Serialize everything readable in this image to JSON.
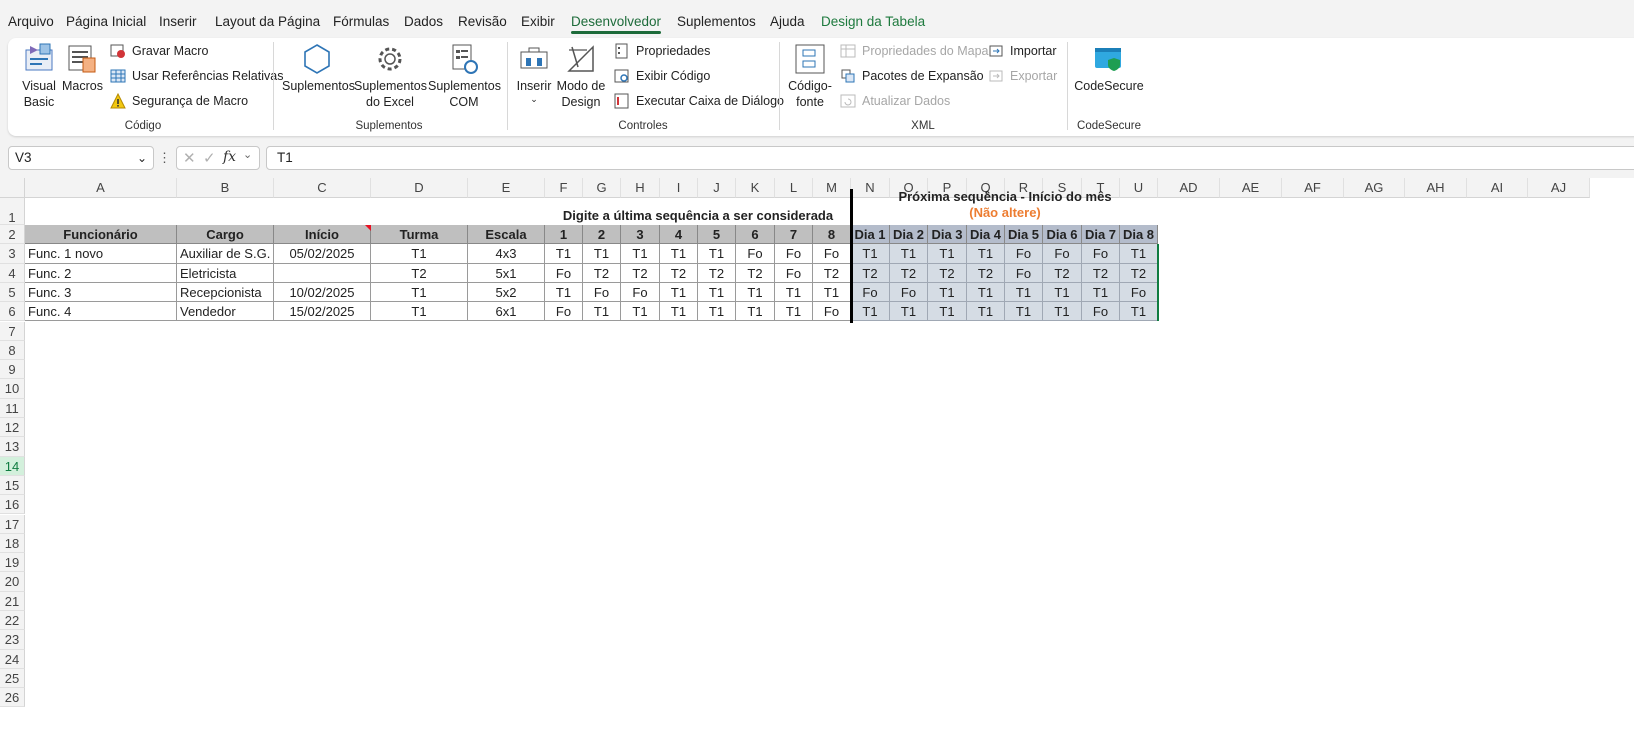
{
  "menu": [
    "Arquivo",
    "Página Inicial",
    "Inserir",
    "Layout da Página",
    "Fórmulas",
    "Dados",
    "Revisão",
    "Exibir",
    "Desenvolvedor",
    "Suplementos",
    "Ajuda",
    "Design da Tabela"
  ],
  "ribbon": {
    "codigo": {
      "label": "Código",
      "visual_basic": "Visual\nBasic",
      "macros": "Macros",
      "gravar_macro": "Gravar Macro",
      "usar_refs": "Usar Referências Relativas",
      "seguranca": "Segurança de Macro"
    },
    "suplementos": {
      "label": "Suplementos",
      "suplementos": "Suplementos",
      "suplementos_excel": "Suplementos\ndo Excel",
      "suplementos_com": "Suplementos\nCOM"
    },
    "controles": {
      "label": "Controles",
      "inserir": "Inserir",
      "modo_design": "Modo de\nDesign",
      "propriedades": "Propriedades",
      "exibir_codigo": "Exibir Código",
      "executar": "Executar Caixa de Diálogo"
    },
    "xml": {
      "label": "XML",
      "codigo_fonte": "Código-\nfonte",
      "prop_mapa": "Propriedades do Mapa",
      "pacotes": "Pacotes de Expansão",
      "atualizar": "Atualizar Dados",
      "importar": "Importar",
      "exportar": "Exportar"
    },
    "codesecure": {
      "label": "CodeSecure",
      "btn": "CodeSecure"
    }
  },
  "namebox": "V3",
  "formula": "T1",
  "columns": [
    "A",
    "B",
    "C",
    "D",
    "E",
    "F",
    "G",
    "H",
    "I",
    "J",
    "K",
    "L",
    "M",
    "N",
    "O",
    "P",
    "Q",
    "R",
    "S",
    "T",
    "U",
    "AD",
    "AE",
    "AF",
    "AG",
    "AH",
    "AI",
    "AJ"
  ],
  "rows": [
    "1",
    "2",
    "3",
    "4",
    "5",
    "6",
    "7",
    "8",
    "9",
    "10",
    "11",
    "12",
    "13",
    "14",
    "15",
    "16",
    "17",
    "18",
    "19",
    "20",
    "21",
    "22",
    "23",
    "24",
    "25",
    "26"
  ],
  "table": {
    "title_left": "Digite a última sequência a ser considerada",
    "title_right": "Próxima sequência - Início do mês",
    "title_right_note": "(Não altere)",
    "headers": [
      "Funcionário",
      "Cargo",
      "Início",
      "Turma",
      "Escala",
      "1",
      "2",
      "3",
      "4",
      "5",
      "6",
      "7",
      "8",
      "Dia 1",
      "Dia 2",
      "Dia 3",
      "Dia 4",
      "Dia 5",
      "Dia 6",
      "Dia 7",
      "Dia 8"
    ],
    "rows": [
      [
        "Func. 1 novo",
        "Auxiliar de S.G.",
        "05/02/2025",
        "T1",
        "4x3",
        "T1",
        "T1",
        "T1",
        "T1",
        "T1",
        "Fo",
        "Fo",
        "Fo",
        "T1",
        "T1",
        "T1",
        "T1",
        "Fo",
        "Fo",
        "Fo",
        "T1"
      ],
      [
        "Func. 2",
        "Eletricista",
        "",
        "T2",
        "5x1",
        "Fo",
        "T2",
        "T2",
        "T2",
        "T2",
        "T2",
        "Fo",
        "T2",
        "T2",
        "T2",
        "T2",
        "T2",
        "Fo",
        "T2",
        "T2",
        "T2"
      ],
      [
        "Func. 3",
        "Recepcionista",
        "10/02/2025",
        "T1",
        "5x2",
        "T1",
        "Fo",
        "Fo",
        "T1",
        "T1",
        "T1",
        "T1",
        "T1",
        "Fo",
        "Fo",
        "T1",
        "T1",
        "T1",
        "T1",
        "T1",
        "Fo"
      ],
      [
        "Func. 4",
        "Vendedor",
        "15/02/2025",
        "T1",
        "6x1",
        "Fo",
        "T1",
        "T1",
        "T1",
        "T1",
        "T1",
        "T1",
        "Fo",
        "T1",
        "T1",
        "T1",
        "T1",
        "T1",
        "T1",
        "Fo",
        "T1"
      ]
    ]
  },
  "colors": {
    "accent": "#1d6b3a",
    "note": "#ed7d31",
    "selection": "#107c41"
  }
}
